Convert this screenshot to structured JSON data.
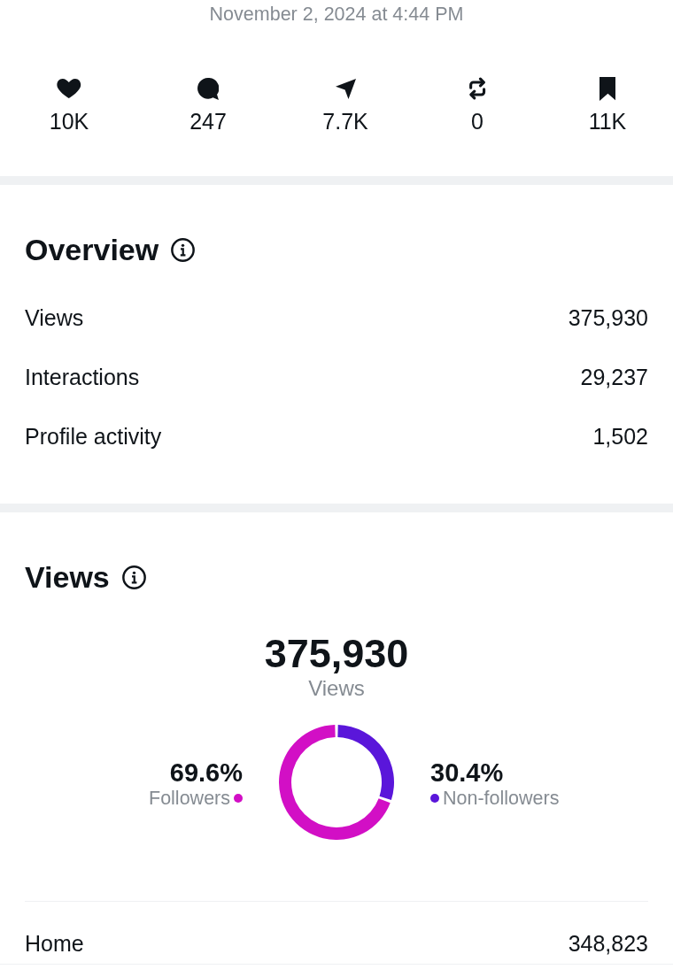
{
  "timestamp": "November 2, 2024 at 4:44 PM",
  "engagement": [
    {
      "kind": "like",
      "value": "10K"
    },
    {
      "kind": "reply",
      "value": "247"
    },
    {
      "kind": "share",
      "value": "7.7K"
    },
    {
      "kind": "repost",
      "value": "0"
    },
    {
      "kind": "bookmark",
      "value": "11K"
    }
  ],
  "overview": {
    "title": "Overview",
    "rows": [
      {
        "label": "Views",
        "value": "375,930"
      },
      {
        "label": "Interactions",
        "value": "29,237"
      },
      {
        "label": "Profile activity",
        "value": "1,502"
      }
    ]
  },
  "views": {
    "title": "Views",
    "total": "375,930",
    "total_label": "Views",
    "chart_data": {
      "type": "donut",
      "categories": [
        "Followers",
        "Non-followers"
      ],
      "values": [
        69.6,
        30.4
      ],
      "value_labels": [
        "69.6%",
        "30.4%"
      ],
      "colors": [
        "#d20fc5",
        "#5a16da"
      ]
    },
    "sources": [
      {
        "label": "Home",
        "value": "348,823"
      }
    ]
  }
}
